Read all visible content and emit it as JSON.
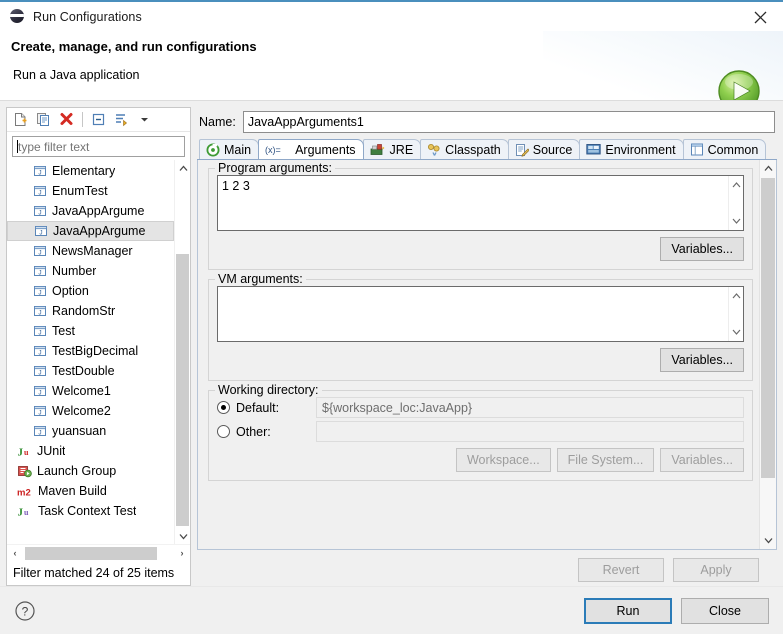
{
  "window": {
    "title": "Run Configurations",
    "icon": "eclipse-icon",
    "close_label": "✕"
  },
  "header": {
    "title": "Create, manage, and run configurations",
    "subtitle": "Run a Java application",
    "badge_icon": "run-green-play-icon"
  },
  "tree_toolbar": {
    "buttons": [
      {
        "name": "new-configuration-button",
        "icon": "new-document-icon",
        "tooltip": "New launch configuration"
      },
      {
        "name": "duplicate-configuration-button",
        "icon": "copy-icon",
        "tooltip": "Duplicate"
      },
      {
        "name": "delete-configuration-button",
        "icon": "delete-red-x-icon",
        "tooltip": "Delete"
      },
      {
        "name": "collapse-all-button",
        "icon": "collapse-all-icon",
        "tooltip": "Collapse All"
      },
      {
        "name": "filter-button",
        "icon": "filter-icon",
        "tooltip": "Filter"
      },
      {
        "name": "view-menu-button",
        "icon": "chevron-down-icon",
        "tooltip": "View Menu"
      }
    ]
  },
  "filter": {
    "value": "",
    "placeholder": "type filter text",
    "status": "Filter matched 24 of 25 items"
  },
  "tree": {
    "items": [
      {
        "label": "Elementary",
        "icon": "java-class-icon",
        "indent": "child",
        "selected": false
      },
      {
        "label": "EnumTest",
        "icon": "java-class-icon",
        "indent": "child",
        "selected": false
      },
      {
        "label": "JavaAppArgume",
        "icon": "java-class-icon",
        "indent": "child",
        "selected": false
      },
      {
        "label": "JavaAppArgume",
        "icon": "java-class-icon",
        "indent": "child",
        "selected": true
      },
      {
        "label": "NewsManager",
        "icon": "java-class-icon",
        "indent": "child",
        "selected": false
      },
      {
        "label": "Number",
        "icon": "java-class-icon",
        "indent": "child",
        "selected": false
      },
      {
        "label": "Option",
        "icon": "java-class-icon",
        "indent": "child",
        "selected": false
      },
      {
        "label": "RandomStr",
        "icon": "java-class-icon",
        "indent": "child",
        "selected": false
      },
      {
        "label": "Test",
        "icon": "java-class-icon",
        "indent": "child",
        "selected": false
      },
      {
        "label": "TestBigDecimal",
        "icon": "java-class-icon",
        "indent": "child",
        "selected": false
      },
      {
        "label": "TestDouble",
        "icon": "java-class-icon",
        "indent": "child",
        "selected": false
      },
      {
        "label": "Welcome1",
        "icon": "java-class-icon",
        "indent": "child",
        "selected": false
      },
      {
        "label": "Welcome2",
        "icon": "java-class-icon",
        "indent": "child",
        "selected": false
      },
      {
        "label": "yuansuan",
        "icon": "java-class-icon",
        "indent": "child",
        "selected": false
      },
      {
        "label": "JUnit",
        "icon": "junit-icon",
        "indent": "root",
        "selected": false
      },
      {
        "label": "Launch Group",
        "icon": "launch-group-icon",
        "indent": "root",
        "selected": false
      },
      {
        "label": "Maven Build",
        "icon": "maven-icon",
        "indent": "root",
        "selected": false
      },
      {
        "label": "Task Context Test",
        "icon": "task-context-test-icon",
        "indent": "root",
        "selected": false
      }
    ]
  },
  "name_field": {
    "label": "Name:",
    "value": "JavaAppArguments1",
    "placeholder": ""
  },
  "tabs": [
    {
      "label": "Main",
      "icon": "main-green-circle-icon",
      "active": false
    },
    {
      "label": "Arguments",
      "icon": "arguments-xequals-icon",
      "active": true
    },
    {
      "label": "JRE",
      "icon": "jre-icon",
      "active": false
    },
    {
      "label": "Classpath",
      "icon": "classpath-icon",
      "active": false
    },
    {
      "label": "Source",
      "icon": "source-icon",
      "active": false
    },
    {
      "label": "Environment",
      "icon": "environment-icon",
      "active": false
    },
    {
      "label": "Common",
      "icon": "common-icon",
      "active": false
    }
  ],
  "arguments_tab": {
    "program_arguments": {
      "title": "Program arguments:",
      "value": "1 2 3",
      "variables_button": "Variables..."
    },
    "vm_arguments": {
      "title": "VM arguments:",
      "value": "",
      "variables_button": "Variables..."
    },
    "working_directory": {
      "title": "Working directory:",
      "default_label": "Default:",
      "default_selected": true,
      "default_value": "${workspace_loc:JavaApp}",
      "other_label": "Other:",
      "other_selected": false,
      "other_value": "",
      "workspace_button": "Workspace...",
      "file_system_button": "File System...",
      "variables_button": "Variables..."
    }
  },
  "actions": {
    "revert": "Revert",
    "revert_enabled": false,
    "apply": "Apply",
    "apply_enabled": false,
    "run": "Run",
    "close": "Close",
    "help_icon": "help-question-icon"
  },
  "colors": {
    "titlebar_accent": "#4a8fbd",
    "tab_border": "#8fa8c8",
    "selection": "#e4e4e4",
    "run_green": "#5aa832",
    "delete_red": "#d42a22",
    "default_button_focus": "#2b7cb8"
  }
}
